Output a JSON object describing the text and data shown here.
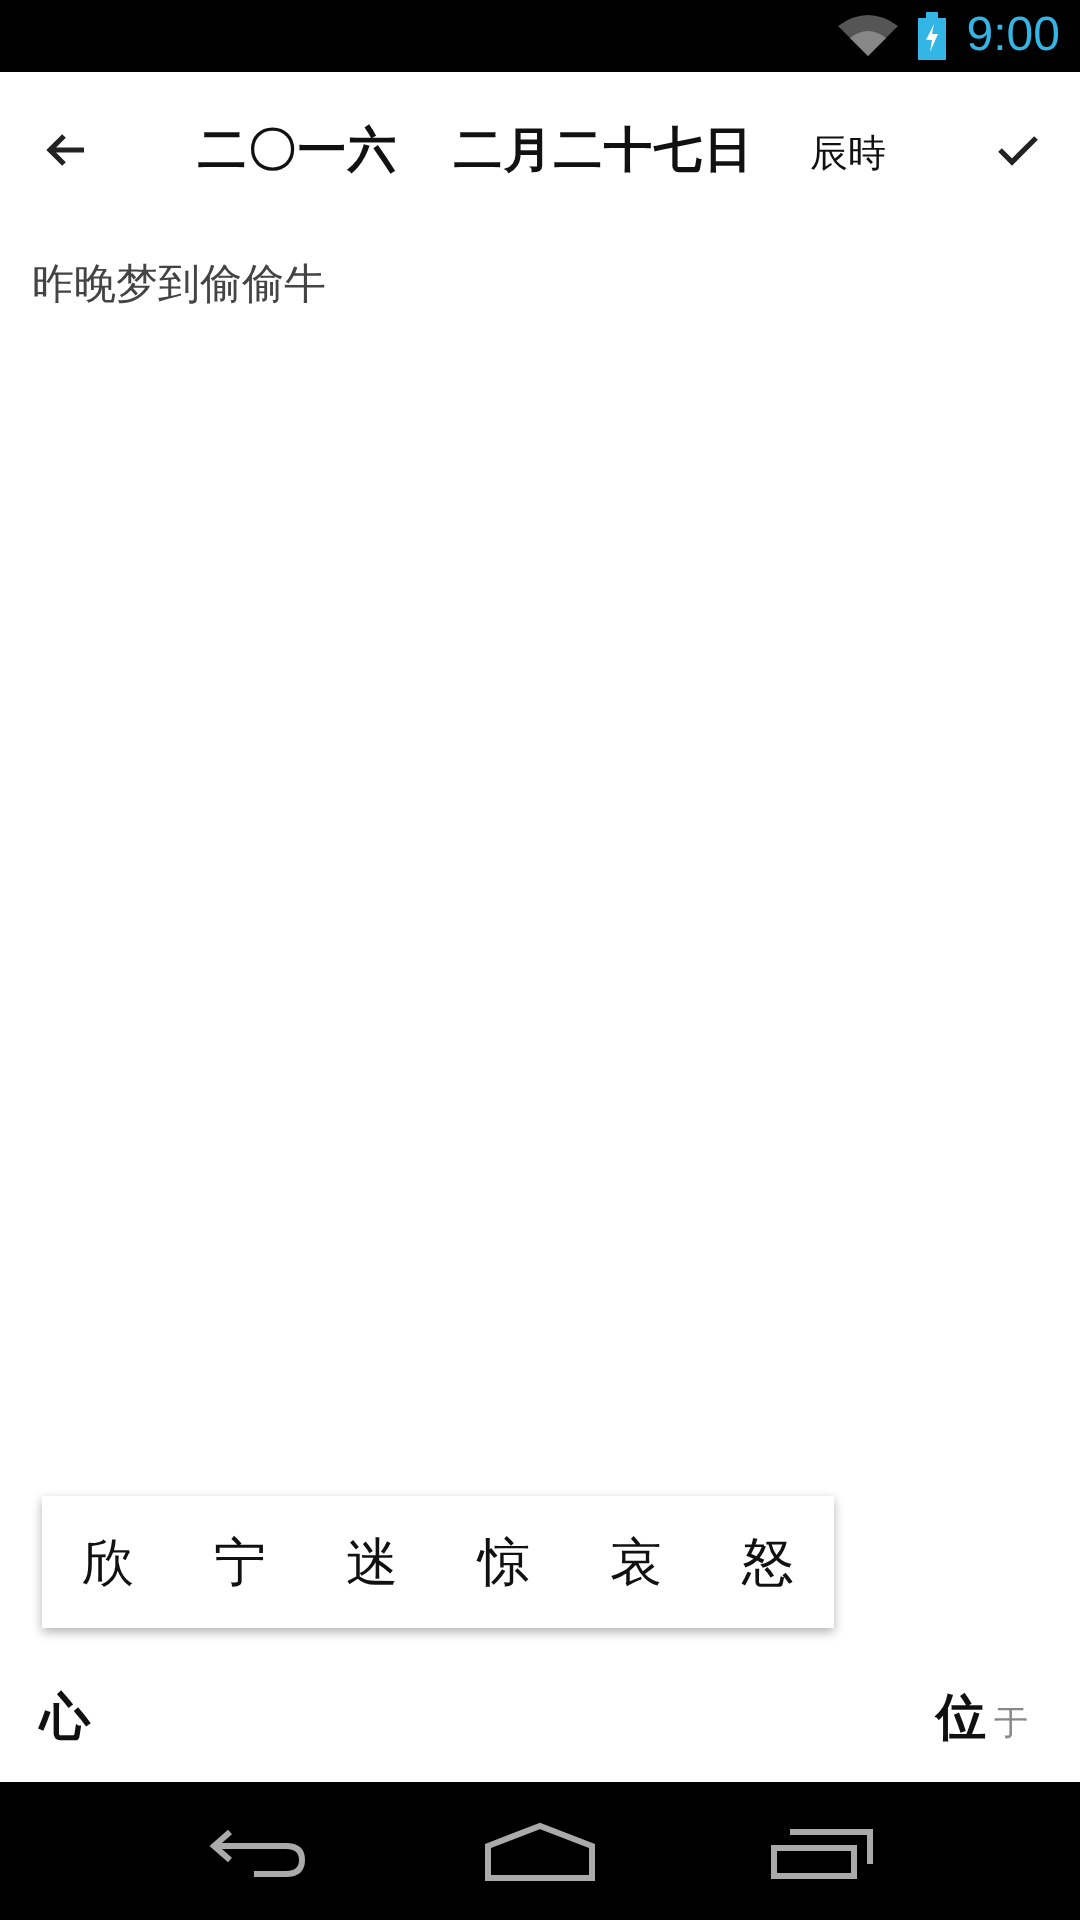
{
  "status_bar": {
    "time": "9:00"
  },
  "header": {
    "year": "二〇一六",
    "date": "二月二十七日",
    "hour": "辰時"
  },
  "note": {
    "value": "昨晚梦到偷偷牛"
  },
  "mood_popup": {
    "options": [
      {
        "label": "欣",
        "selected": false
      },
      {
        "label": "宁",
        "selected": false
      },
      {
        "label": "迷",
        "selected": false
      },
      {
        "label": "惊",
        "selected": false
      },
      {
        "label": "哀",
        "selected": false
      },
      {
        "label": "怒",
        "selected": false
      }
    ]
  },
  "bottom_bar": {
    "left": "心",
    "right": "位",
    "right_hint": "于"
  }
}
